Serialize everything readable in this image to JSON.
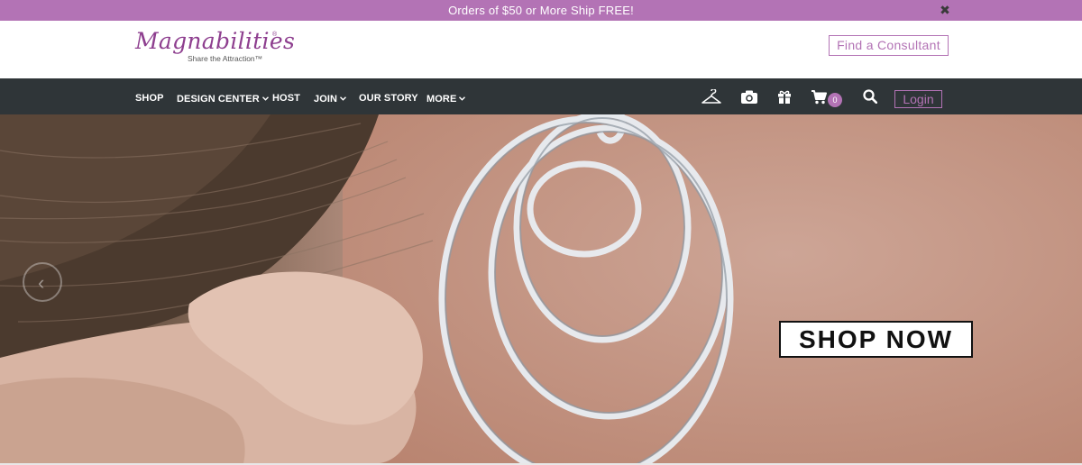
{
  "promo": {
    "text": "Orders of $50 or More Ship FREE!",
    "close_label": "✖"
  },
  "header": {
    "logo_text": "Magnabilities",
    "logo_reg": "®",
    "logo_tagline": "Share the Attraction™",
    "consultant_button": "Find a Consultant"
  },
  "nav": {
    "items": [
      {
        "label": "SHOP",
        "has_dropdown": false
      },
      {
        "label": "DESIGN CENTER",
        "has_dropdown": true
      },
      {
        "label": "HOST",
        "has_dropdown": false
      },
      {
        "label": "JOIN",
        "has_dropdown": true
      },
      {
        "label": "OUR STORY",
        "has_dropdown": false
      },
      {
        "label": "MORE",
        "has_dropdown": true
      }
    ],
    "chevron": "⌄",
    "icons": [
      "hanger-icon",
      "camera-icon",
      "gift-icon",
      "cart-icon",
      "search-icon"
    ],
    "cart_count": "0",
    "login_label": "Login"
  },
  "hero": {
    "cta_label": "SHOP NOW",
    "prev_arrow": "‹"
  },
  "colors": {
    "accent": "#b373b5",
    "nav_bg": "#2f3538",
    "logo": "#8e3f8f"
  }
}
